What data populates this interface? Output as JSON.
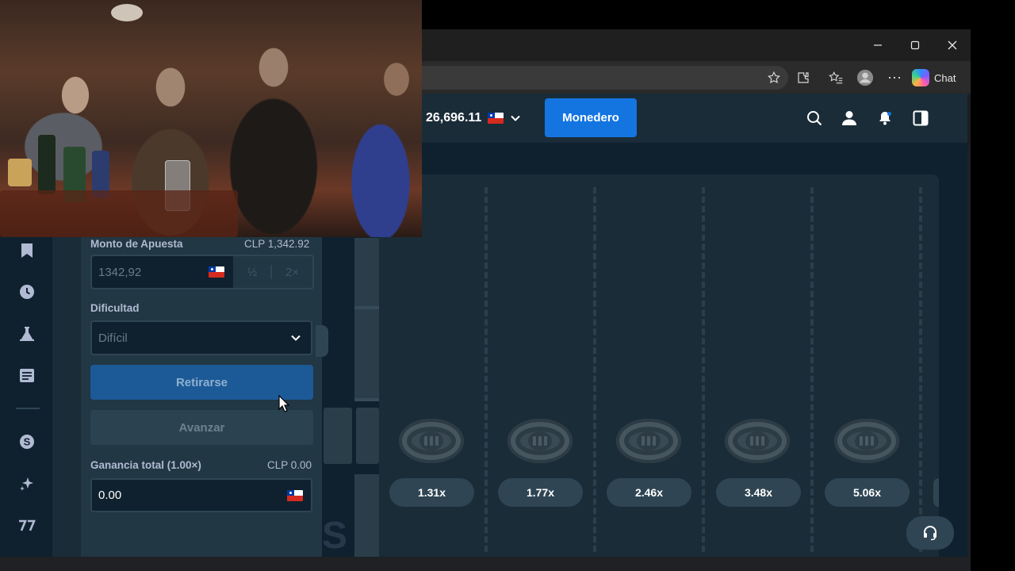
{
  "browser": {
    "chat_label": "Chat"
  },
  "header": {
    "balance": "26,696.11",
    "wallet_label": "Monedero"
  },
  "panel": {
    "bet_amount_label": "Monto de Apuesta",
    "bet_amount_value_text": "CLP 1,342.92",
    "bet_input_value": "1342,92",
    "half_label": "½",
    "double_label": "2×",
    "difficulty_label": "Dificultad",
    "difficulty_value": "Difícil",
    "cashout_label": "Retirarse",
    "advance_label": "Avanzar",
    "total_profit_label": "Ganancia total (1.00×)",
    "total_profit_value_text": "CLP 0.00",
    "profit_input_value": "0.00"
  },
  "game": {
    "multipliers": [
      "1.31x",
      "1.77x",
      "2.46x",
      "3.48x",
      "5.06x"
    ]
  },
  "colors": {
    "accent_blue": "#1475e1",
    "panel_bg": "#213743",
    "game_bg": "#0f212e"
  }
}
